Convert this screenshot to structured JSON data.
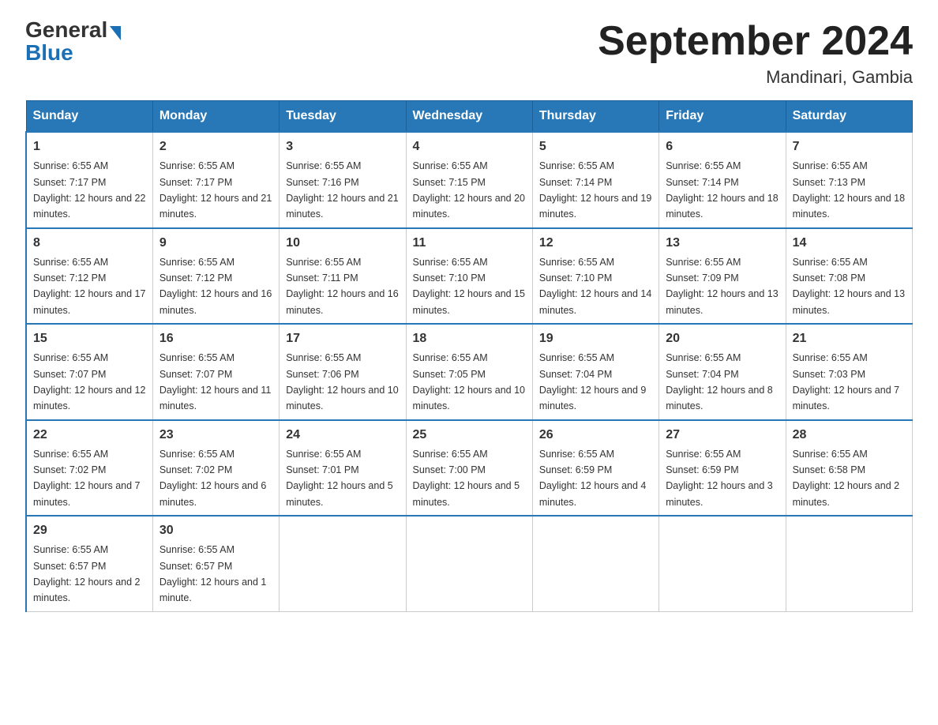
{
  "header": {
    "logo_general": "General",
    "logo_blue": "Blue",
    "month_title": "September 2024",
    "location": "Mandinari, Gambia"
  },
  "days_of_week": [
    "Sunday",
    "Monday",
    "Tuesday",
    "Wednesday",
    "Thursday",
    "Friday",
    "Saturday"
  ],
  "weeks": [
    [
      {
        "day": "1",
        "sunrise": "Sunrise: 6:55 AM",
        "sunset": "Sunset: 7:17 PM",
        "daylight": "Daylight: 12 hours and 22 minutes."
      },
      {
        "day": "2",
        "sunrise": "Sunrise: 6:55 AM",
        "sunset": "Sunset: 7:17 PM",
        "daylight": "Daylight: 12 hours and 21 minutes."
      },
      {
        "day": "3",
        "sunrise": "Sunrise: 6:55 AM",
        "sunset": "Sunset: 7:16 PM",
        "daylight": "Daylight: 12 hours and 21 minutes."
      },
      {
        "day": "4",
        "sunrise": "Sunrise: 6:55 AM",
        "sunset": "Sunset: 7:15 PM",
        "daylight": "Daylight: 12 hours and 20 minutes."
      },
      {
        "day": "5",
        "sunrise": "Sunrise: 6:55 AM",
        "sunset": "Sunset: 7:14 PM",
        "daylight": "Daylight: 12 hours and 19 minutes."
      },
      {
        "day": "6",
        "sunrise": "Sunrise: 6:55 AM",
        "sunset": "Sunset: 7:14 PM",
        "daylight": "Daylight: 12 hours and 18 minutes."
      },
      {
        "day": "7",
        "sunrise": "Sunrise: 6:55 AM",
        "sunset": "Sunset: 7:13 PM",
        "daylight": "Daylight: 12 hours and 18 minutes."
      }
    ],
    [
      {
        "day": "8",
        "sunrise": "Sunrise: 6:55 AM",
        "sunset": "Sunset: 7:12 PM",
        "daylight": "Daylight: 12 hours and 17 minutes."
      },
      {
        "day": "9",
        "sunrise": "Sunrise: 6:55 AM",
        "sunset": "Sunset: 7:12 PM",
        "daylight": "Daylight: 12 hours and 16 minutes."
      },
      {
        "day": "10",
        "sunrise": "Sunrise: 6:55 AM",
        "sunset": "Sunset: 7:11 PM",
        "daylight": "Daylight: 12 hours and 16 minutes."
      },
      {
        "day": "11",
        "sunrise": "Sunrise: 6:55 AM",
        "sunset": "Sunset: 7:10 PM",
        "daylight": "Daylight: 12 hours and 15 minutes."
      },
      {
        "day": "12",
        "sunrise": "Sunrise: 6:55 AM",
        "sunset": "Sunset: 7:10 PM",
        "daylight": "Daylight: 12 hours and 14 minutes."
      },
      {
        "day": "13",
        "sunrise": "Sunrise: 6:55 AM",
        "sunset": "Sunset: 7:09 PM",
        "daylight": "Daylight: 12 hours and 13 minutes."
      },
      {
        "day": "14",
        "sunrise": "Sunrise: 6:55 AM",
        "sunset": "Sunset: 7:08 PM",
        "daylight": "Daylight: 12 hours and 13 minutes."
      }
    ],
    [
      {
        "day": "15",
        "sunrise": "Sunrise: 6:55 AM",
        "sunset": "Sunset: 7:07 PM",
        "daylight": "Daylight: 12 hours and 12 minutes."
      },
      {
        "day": "16",
        "sunrise": "Sunrise: 6:55 AM",
        "sunset": "Sunset: 7:07 PM",
        "daylight": "Daylight: 12 hours and 11 minutes."
      },
      {
        "day": "17",
        "sunrise": "Sunrise: 6:55 AM",
        "sunset": "Sunset: 7:06 PM",
        "daylight": "Daylight: 12 hours and 10 minutes."
      },
      {
        "day": "18",
        "sunrise": "Sunrise: 6:55 AM",
        "sunset": "Sunset: 7:05 PM",
        "daylight": "Daylight: 12 hours and 10 minutes."
      },
      {
        "day": "19",
        "sunrise": "Sunrise: 6:55 AM",
        "sunset": "Sunset: 7:04 PM",
        "daylight": "Daylight: 12 hours and 9 minutes."
      },
      {
        "day": "20",
        "sunrise": "Sunrise: 6:55 AM",
        "sunset": "Sunset: 7:04 PM",
        "daylight": "Daylight: 12 hours and 8 minutes."
      },
      {
        "day": "21",
        "sunrise": "Sunrise: 6:55 AM",
        "sunset": "Sunset: 7:03 PM",
        "daylight": "Daylight: 12 hours and 7 minutes."
      }
    ],
    [
      {
        "day": "22",
        "sunrise": "Sunrise: 6:55 AM",
        "sunset": "Sunset: 7:02 PM",
        "daylight": "Daylight: 12 hours and 7 minutes."
      },
      {
        "day": "23",
        "sunrise": "Sunrise: 6:55 AM",
        "sunset": "Sunset: 7:02 PM",
        "daylight": "Daylight: 12 hours and 6 minutes."
      },
      {
        "day": "24",
        "sunrise": "Sunrise: 6:55 AM",
        "sunset": "Sunset: 7:01 PM",
        "daylight": "Daylight: 12 hours and 5 minutes."
      },
      {
        "day": "25",
        "sunrise": "Sunrise: 6:55 AM",
        "sunset": "Sunset: 7:00 PM",
        "daylight": "Daylight: 12 hours and 5 minutes."
      },
      {
        "day": "26",
        "sunrise": "Sunrise: 6:55 AM",
        "sunset": "Sunset: 6:59 PM",
        "daylight": "Daylight: 12 hours and 4 minutes."
      },
      {
        "day": "27",
        "sunrise": "Sunrise: 6:55 AM",
        "sunset": "Sunset: 6:59 PM",
        "daylight": "Daylight: 12 hours and 3 minutes."
      },
      {
        "day": "28",
        "sunrise": "Sunrise: 6:55 AM",
        "sunset": "Sunset: 6:58 PM",
        "daylight": "Daylight: 12 hours and 2 minutes."
      }
    ],
    [
      {
        "day": "29",
        "sunrise": "Sunrise: 6:55 AM",
        "sunset": "Sunset: 6:57 PM",
        "daylight": "Daylight: 12 hours and 2 minutes."
      },
      {
        "day": "30",
        "sunrise": "Sunrise: 6:55 AM",
        "sunset": "Sunset: 6:57 PM",
        "daylight": "Daylight: 12 hours and 1 minute."
      },
      null,
      null,
      null,
      null,
      null
    ]
  ]
}
